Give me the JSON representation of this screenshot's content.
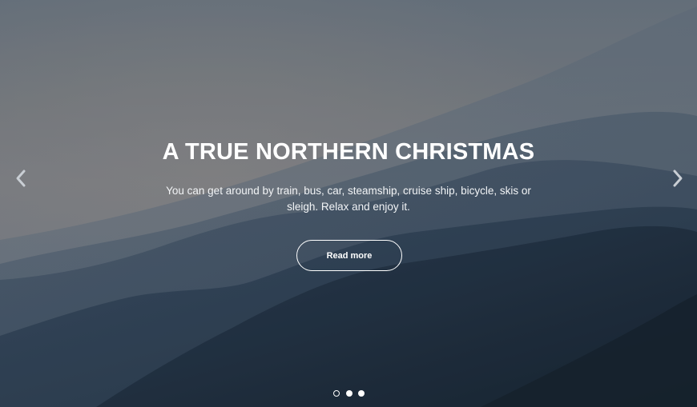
{
  "slide": {
    "title": "A TRUE NORTHERN CHRISTMAS",
    "text": "You can get around by train, bus, car, steamship, cruise ship, bicycle, skis or sleigh. Relax and enjoy it.",
    "button_label": "Read more"
  },
  "controls": {
    "prev_icon": "chevron-left-icon",
    "next_icon": "chevron-right-icon",
    "slide_count": 3,
    "active_slide": 1
  },
  "colors": {
    "sky_top": "#6f7983",
    "sky_glow": "#8a8a8c",
    "mountain_dark": "#1f2d3b",
    "text": "#ffffff"
  }
}
